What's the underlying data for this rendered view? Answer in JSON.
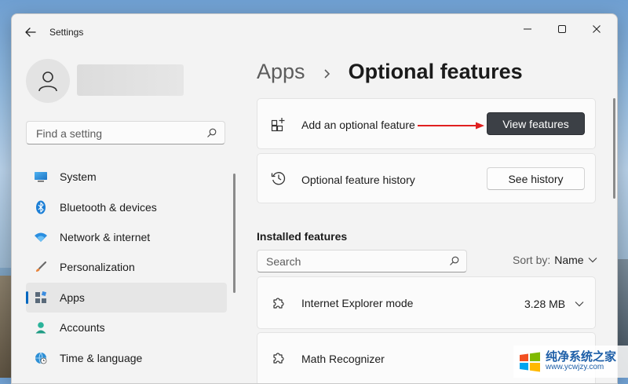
{
  "window": {
    "title": "Settings"
  },
  "sidebar": {
    "find_placeholder": "Find a setting",
    "items": [
      {
        "label": "System",
        "icon": "monitor-icon"
      },
      {
        "label": "Bluetooth & devices",
        "icon": "bluetooth-icon"
      },
      {
        "label": "Network & internet",
        "icon": "wifi-icon"
      },
      {
        "label": "Personalization",
        "icon": "brush-icon"
      },
      {
        "label": "Apps",
        "icon": "apps-icon",
        "active": true
      },
      {
        "label": "Accounts",
        "icon": "person-icon"
      },
      {
        "label": "Time & language",
        "icon": "globe-clock-icon"
      }
    ]
  },
  "breadcrumb": {
    "parent": "Apps",
    "separator": "›",
    "title": "Optional features"
  },
  "cards": {
    "add": {
      "label": "Add an optional feature",
      "button": "View features",
      "icon": "add-feature-icon"
    },
    "history": {
      "label": "Optional feature history",
      "button": "See history",
      "icon": "history-icon"
    }
  },
  "installed": {
    "heading": "Installed features",
    "search_placeholder": "Search",
    "sort_label": "Sort by:",
    "sort_value": "Name",
    "features": [
      {
        "name": "Internet Explorer mode",
        "size": "3.28 MB",
        "icon": "puzzle-icon"
      },
      {
        "name": "Math Recognizer",
        "size": "",
        "icon": "puzzle-icon"
      }
    ]
  },
  "watermark": {
    "site_name": "纯净系统之家",
    "url": "www.ycwjzy.com"
  },
  "colors": {
    "accent": "#0067c0",
    "primary_button": "#3c4046",
    "annotation_arrow": "#e02020"
  }
}
